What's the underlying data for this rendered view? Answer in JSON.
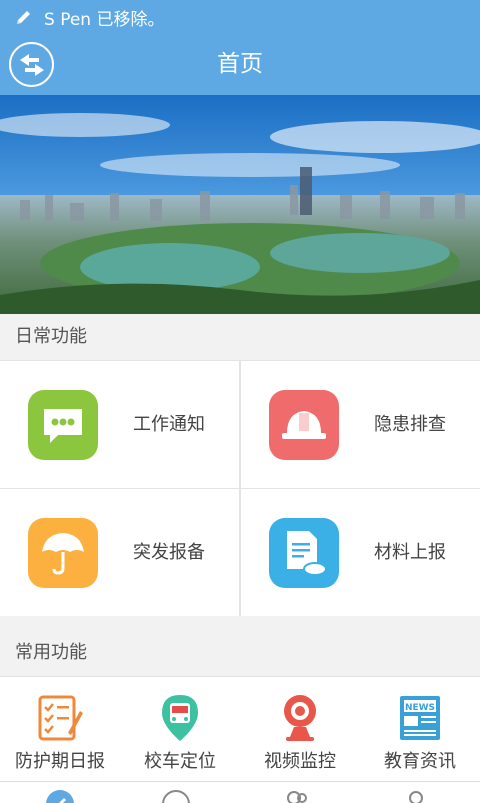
{
  "status_bar": {
    "text": "S Pen 已移除。"
  },
  "header": {
    "title": "首页"
  },
  "sections": {
    "daily": "日常功能",
    "common": "常用功能"
  },
  "daily_items": [
    {
      "label": "工作通知",
      "icon": "message-dots-icon",
      "color": "#8cc63f"
    },
    {
      "label": "隐患排查",
      "icon": "hard-hat-icon",
      "color": "#f06c6c"
    },
    {
      "label": "突发报备",
      "icon": "umbrella-icon",
      "color": "#fbb040"
    },
    {
      "label": "材料上报",
      "icon": "document-cloud-icon",
      "color": "#3ab0e6"
    }
  ],
  "common_items": [
    {
      "label": "防护期日报",
      "icon": "report-checklist-icon"
    },
    {
      "label": "校车定位",
      "icon": "bus-location-icon"
    },
    {
      "label": "视频监控",
      "icon": "webcam-icon"
    },
    {
      "label": "教育资讯",
      "icon": "news-icon"
    }
  ],
  "colors": {
    "primary": "#5ea9e4"
  }
}
